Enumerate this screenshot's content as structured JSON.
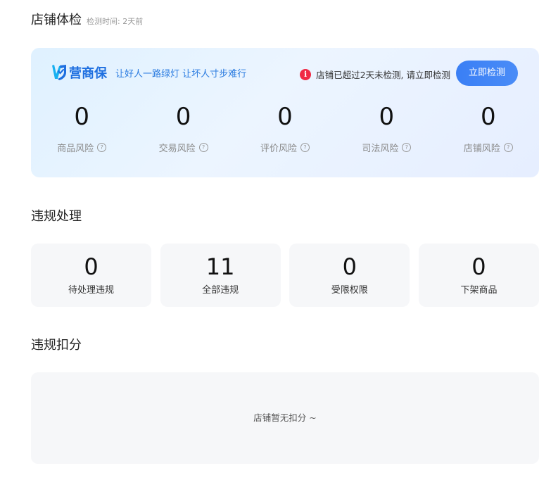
{
  "health": {
    "title": "店铺体检",
    "check_time": "检测时间: 2天前",
    "brand": {
      "name": "营商保",
      "slogan": "让好人一路绿灯 让坏人寸步难行",
      "logo_icon": "shield-check-icon",
      "color": "#1e6fe0"
    },
    "alert": {
      "icon": "info-icon",
      "text": "店铺已超过2天未检测, 请立即检测",
      "color": "#f02a45"
    },
    "detect_button": "立即检测",
    "risks": [
      {
        "value": "0",
        "label": "商品风险"
      },
      {
        "value": "0",
        "label": "交易风险"
      },
      {
        "value": "0",
        "label": "评价风险"
      },
      {
        "value": "0",
        "label": "司法风险"
      },
      {
        "value": "0",
        "label": "店铺风险"
      }
    ]
  },
  "violation": {
    "title": "违规处理",
    "stats": [
      {
        "value": "0",
        "label": "待处理违规"
      },
      {
        "value": "11",
        "label": "全部违规"
      },
      {
        "value": "0",
        "label": "受限权限"
      },
      {
        "value": "0",
        "label": "下架商品"
      }
    ]
  },
  "deduction": {
    "title": "违规扣分",
    "empty_text": "店铺暂无扣分 ~"
  },
  "colors": {
    "accent": "#3b82f6",
    "card_bg": "#f6f7f9"
  }
}
